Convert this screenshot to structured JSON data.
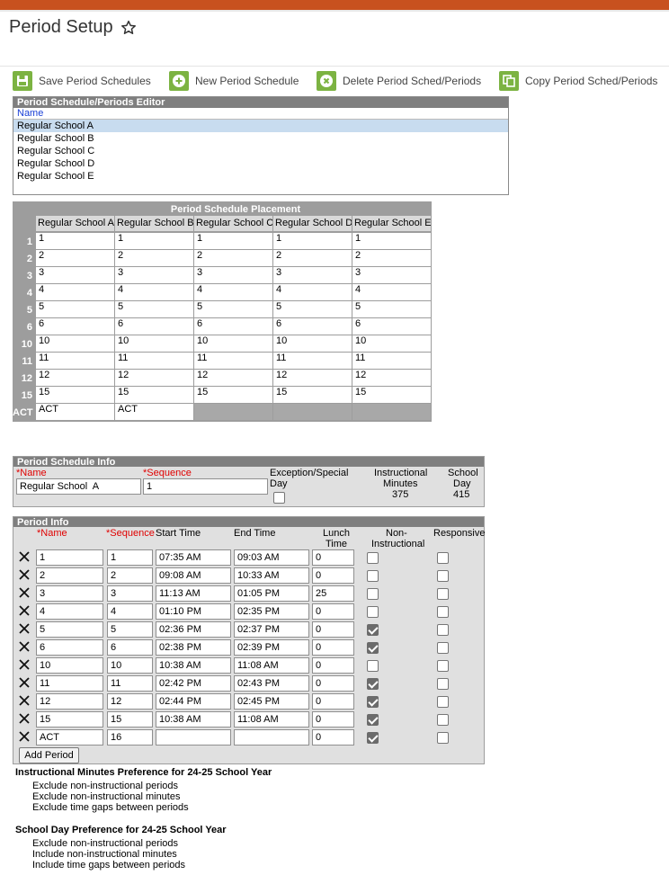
{
  "page": {
    "title": "Period Setup"
  },
  "toolbar": {
    "save": "Save Period Schedules",
    "new": "New Period Schedule",
    "delete": "Delete Period Sched/Periods",
    "copy": "Copy Period Sched/Periods"
  },
  "editor": {
    "title": "Period Schedule/Periods Editor",
    "column": "Name",
    "items": [
      "Regular School A",
      "Regular School B",
      "Regular School C",
      "Regular School D",
      "Regular School E"
    ]
  },
  "placement": {
    "title": "Period Schedule Placement",
    "columns": [
      "Regular School A",
      "Regular School B",
      "Regular School C",
      "Regular School D",
      "Regular School E"
    ],
    "rows": [
      {
        "label": "1",
        "cells": [
          "1",
          "1",
          "1",
          "1",
          "1"
        ]
      },
      {
        "label": "2",
        "cells": [
          "2",
          "2",
          "2",
          "2",
          "2"
        ]
      },
      {
        "label": "3",
        "cells": [
          "3",
          "3",
          "3",
          "3",
          "3"
        ]
      },
      {
        "label": "4",
        "cells": [
          "4",
          "4",
          "4",
          "4",
          "4"
        ]
      },
      {
        "label": "5",
        "cells": [
          "5",
          "5",
          "5",
          "5",
          "5"
        ]
      },
      {
        "label": "6",
        "cells": [
          "6",
          "6",
          "6",
          "6",
          "6"
        ]
      },
      {
        "label": "10",
        "cells": [
          "10",
          "10",
          "10",
          "10",
          "10"
        ]
      },
      {
        "label": "11",
        "cells": [
          "11",
          "11",
          "11",
          "11",
          "11"
        ]
      },
      {
        "label": "12",
        "cells": [
          "12",
          "12",
          "12",
          "12",
          "12"
        ]
      },
      {
        "label": "15",
        "cells": [
          "15",
          "15",
          "15",
          "15",
          "15"
        ]
      },
      {
        "label": "ACT",
        "cells": [
          "ACT",
          "ACT",
          null,
          null,
          null
        ]
      }
    ]
  },
  "schedule_info": {
    "title": "Period Schedule Info",
    "name_label": "*Name",
    "name_value": "Regular School  A",
    "sequence_label": "*Sequence",
    "sequence_value": "1",
    "exception_label_1": "Exception/Special",
    "exception_label_2": "Day",
    "exception_checked": false,
    "instr_label_1": "Instructional",
    "instr_label_2": "Minutes",
    "instr_value": "375",
    "school_day_label_1": "School",
    "school_day_label_2": "Day",
    "school_day_value": "415"
  },
  "period_info": {
    "title": "Period Info",
    "headers": {
      "name": "*Name",
      "sequence": "*Sequence",
      "start": "Start Time",
      "end": "End Time",
      "lunch_1": "Lunch",
      "lunch_2": "Time",
      "noninstr_1": "Non-",
      "noninstr_2": "Instructional",
      "responsive": "Responsive"
    },
    "rows": [
      {
        "name": "1",
        "seq": "1",
        "start": "07:35 AM",
        "end": "09:03 AM",
        "lunch": "0",
        "noninstr": false,
        "resp": false
      },
      {
        "name": "2",
        "seq": "2",
        "start": "09:08 AM",
        "end": "10:33 AM",
        "lunch": "0",
        "noninstr": false,
        "resp": false
      },
      {
        "name": "3",
        "seq": "3",
        "start": "11:13 AM",
        "end": "01:05 PM",
        "lunch": "25",
        "noninstr": false,
        "resp": false
      },
      {
        "name": "4",
        "seq": "4",
        "start": "01:10 PM",
        "end": "02:35 PM",
        "lunch": "0",
        "noninstr": false,
        "resp": false
      },
      {
        "name": "5",
        "seq": "5",
        "start": "02:36 PM",
        "end": "02:37 PM",
        "lunch": "0",
        "noninstr": true,
        "resp": false
      },
      {
        "name": "6",
        "seq": "6",
        "start": "02:38 PM",
        "end": "02:39 PM",
        "lunch": "0",
        "noninstr": true,
        "resp": false
      },
      {
        "name": "10",
        "seq": "10",
        "start": "10:38 AM",
        "end": "11:08 AM",
        "lunch": "0",
        "noninstr": false,
        "resp": false
      },
      {
        "name": "11",
        "seq": "11",
        "start": "02:42 PM",
        "end": "02:43 PM",
        "lunch": "0",
        "noninstr": true,
        "resp": false
      },
      {
        "name": "12",
        "seq": "12",
        "start": "02:44 PM",
        "end": "02:45 PM",
        "lunch": "0",
        "noninstr": true,
        "resp": false
      },
      {
        "name": "15",
        "seq": "15",
        "start": "10:38 AM",
        "end": "11:08 AM",
        "lunch": "0",
        "noninstr": true,
        "resp": false
      },
      {
        "name": "ACT",
        "seq": "16",
        "start": "",
        "end": "",
        "lunch": "0",
        "noninstr": true,
        "resp": false
      }
    ],
    "add_button": "Add Period"
  },
  "preferences": {
    "instr_title": "Instructional Minutes Preference for 24-25 School Year",
    "instr_lines": [
      "Exclude non-instructional periods",
      "Exclude non-instructional minutes",
      "Exclude time gaps between periods"
    ],
    "day_title": "School Day Preference for 24-25 School Year",
    "day_lines": [
      "Exclude non-instructional periods",
      "Include non-instructional minutes",
      "Include time gaps between periods"
    ]
  },
  "colors": {
    "accent": "#c8511f",
    "button_green": "#7cb342",
    "header_gray": "#7f7f7f",
    "selected_row": "#c8dcef"
  }
}
